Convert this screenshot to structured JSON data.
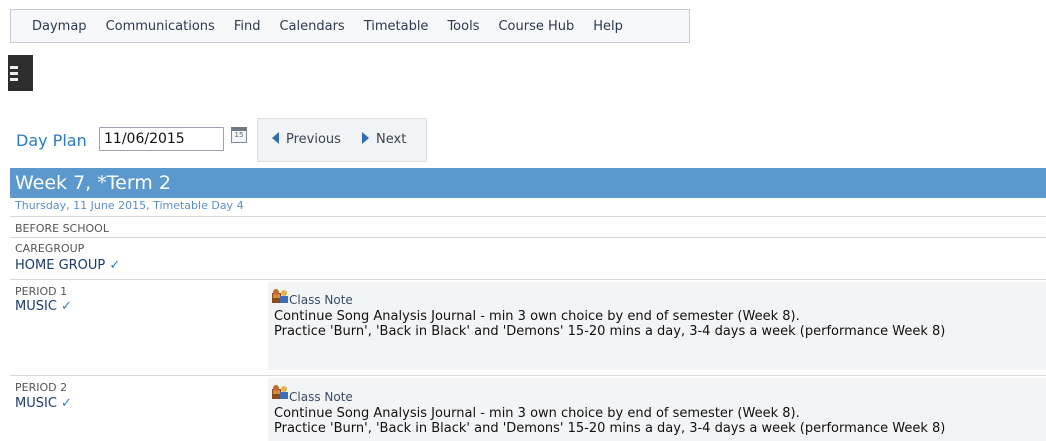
{
  "menu": {
    "items": [
      "Daymap",
      "Communications",
      "Find",
      "Calendars",
      "Timetable",
      "Tools",
      "Course Hub",
      "Help"
    ]
  },
  "dayplan": {
    "label": "Day Plan",
    "date": "11/06/2015",
    "calendar_icon_text": "15",
    "previous_label": "Previous",
    "next_label": "Next"
  },
  "week": {
    "title": "Week 7, *Term 2",
    "subtitle": "Thursday, 11 June 2015, Timetable Day 4"
  },
  "periods": {
    "before_school": "BEFORE SCHOOL",
    "caregroup": {
      "label": "CAREGROUP",
      "subject": "HOME GROUP"
    },
    "period1": {
      "label": "PERIOD 1",
      "subject": "MUSIC",
      "note_title": "Class Note",
      "line1": "Continue Song Analysis Journal - min 3 own choice by end of semester (Week 8).",
      "line2": "Practice 'Burn', 'Back in Black' and 'Demons' 15-20 mins a day, 3-4 days a week (performance Week 8)"
    },
    "period2": {
      "label": "PERIOD 2",
      "subject": "MUSIC",
      "note_title": "Class Note",
      "line1": "Continue Song Analysis Journal - min 3 own choice by end of semester (Week 8).",
      "line2": "Practice 'Burn', 'Back in Black' and 'Demons' 15-20 mins a day, 3-4 days a week (performance Week 8)"
    }
  },
  "colors": {
    "accent": "#2a7cc2",
    "week_bar": "#5b98ce",
    "tick": "#2f7bd0"
  },
  "icons": {
    "menu": "hamburger-icon",
    "calendar": "calendar-icon",
    "note": "class-note-icon",
    "check": "check-icon"
  }
}
